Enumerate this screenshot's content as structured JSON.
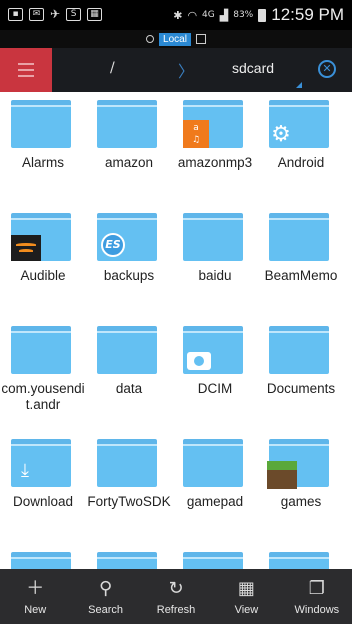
{
  "status_bar": {
    "time": "12:59 PM",
    "battery": "83%",
    "network": "4G"
  },
  "location": {
    "chip": "Local"
  },
  "toolbar": {
    "root_crumb": "/",
    "current_crumb": "sdcard"
  },
  "folders": [
    {
      "name": "Alarms",
      "badge": ""
    },
    {
      "name": "amazon",
      "badge": ""
    },
    {
      "name": "amazonmp3",
      "badge": "amazon-mp3-icon"
    },
    {
      "name": "Android",
      "badge": "gear-icon"
    },
    {
      "name": "Audible",
      "badge": "audible-icon"
    },
    {
      "name": "backups",
      "badge": "es-icon"
    },
    {
      "name": "baidu",
      "badge": ""
    },
    {
      "name": "BeamMemo",
      "badge": ""
    },
    {
      "name": "com.yousendit.andr",
      "badge": ""
    },
    {
      "name": "data",
      "badge": ""
    },
    {
      "name": "DCIM",
      "badge": "camera-icon"
    },
    {
      "name": "Documents",
      "badge": ""
    },
    {
      "name": "Download",
      "badge": "download-icon"
    },
    {
      "name": "FortyTwoSDK",
      "badge": ""
    },
    {
      "name": "gamepad",
      "badge": ""
    },
    {
      "name": "games",
      "badge": "minecraft-icon"
    }
  ],
  "bottom_bar": {
    "new": "New",
    "search": "Search",
    "refresh": "Refresh",
    "view": "View",
    "windows": "Windows"
  },
  "colors": {
    "folder": "#64c0f2",
    "menu_button": "#c9353f",
    "toolbar": "#1a1c20",
    "accent": "#3a90d8",
    "bottom_bar": "#2c2c2e"
  }
}
